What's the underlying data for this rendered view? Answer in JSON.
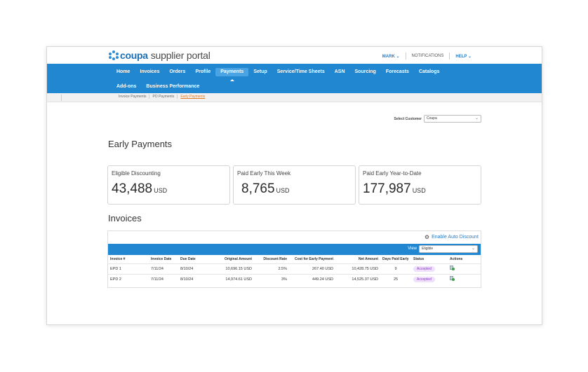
{
  "brand": {
    "name_bold": "coupa",
    "name_rest": "supplier portal",
    "accent": "#2187d1"
  },
  "toplinks": {
    "user": "MARK",
    "notifications": "NOTIFICATIONS",
    "help": "HELP"
  },
  "nav": {
    "row1": [
      "Home",
      "Invoices",
      "Orders",
      "Profile",
      "Payments",
      "Setup",
      "Service/Time Sheets",
      "ASN",
      "Sourcing",
      "Forecasts",
      "Catalogs"
    ],
    "row2": [
      "Add-ons",
      "Business Performance"
    ],
    "active": "Payments"
  },
  "subnav": [
    "Invoice Payments",
    "PO Payments",
    "Early Payments"
  ],
  "customer": {
    "label": "Select Customer",
    "value": "Coupa"
  },
  "page_title": "Early Payments",
  "cards": [
    {
      "title": "Eligible Discounting",
      "value": "43,488",
      "unit": "USD"
    },
    {
      "title": "Paid Early This Week",
      "value": "8,765",
      "unit": "USD"
    },
    {
      "title": "Paid Early Year-to-Date",
      "value": "177,987",
      "unit": "USD"
    }
  ],
  "invoices": {
    "title": "Invoices",
    "auto_discount": "Enable Auto Discount",
    "view_label": "View",
    "view_value": "Eligible",
    "columns": [
      "Invoice #",
      "Invoice Date",
      "Due Date",
      "Original Amount",
      "Discount Rate",
      "Cost for Early Payment",
      "Net Amount",
      "Days Paid Early",
      "Status",
      "Actions"
    ],
    "rows": [
      {
        "invoice": "EPD 1",
        "invoice_date": "7/11/24",
        "due_date": "8/10/24",
        "original": "10,696.15 USD",
        "rate": "2.5%",
        "cost": "267.40 USD",
        "net": "10,428.75 USD",
        "days": "9",
        "status": "Accepted"
      },
      {
        "invoice": "EPD 2",
        "invoice_date": "7/11/24",
        "due_date": "8/10/24",
        "original": "14,974.61 USD",
        "rate": "3%",
        "cost": "449.24 USD",
        "net": "14,525.37 USD",
        "days": "25",
        "status": "Accepted"
      }
    ]
  }
}
